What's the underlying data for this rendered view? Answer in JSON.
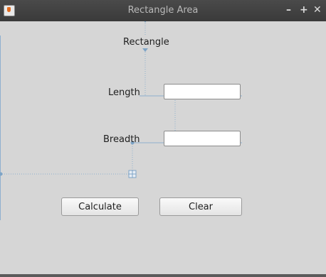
{
  "window": {
    "title": "Rectangle Area",
    "controls": {
      "minimize": "–",
      "maximize": "+",
      "close": "✕"
    }
  },
  "form": {
    "heading": "Rectangle",
    "length_label": "Length",
    "length_value": "",
    "breadth_label": "Breadth",
    "breadth_value": ""
  },
  "buttons": {
    "calculate": "Calculate",
    "clear": "Clear"
  },
  "colors": {
    "titlebar": "#3f3f3f",
    "background": "#d6d6d6",
    "guide": "#7ea4c6"
  }
}
